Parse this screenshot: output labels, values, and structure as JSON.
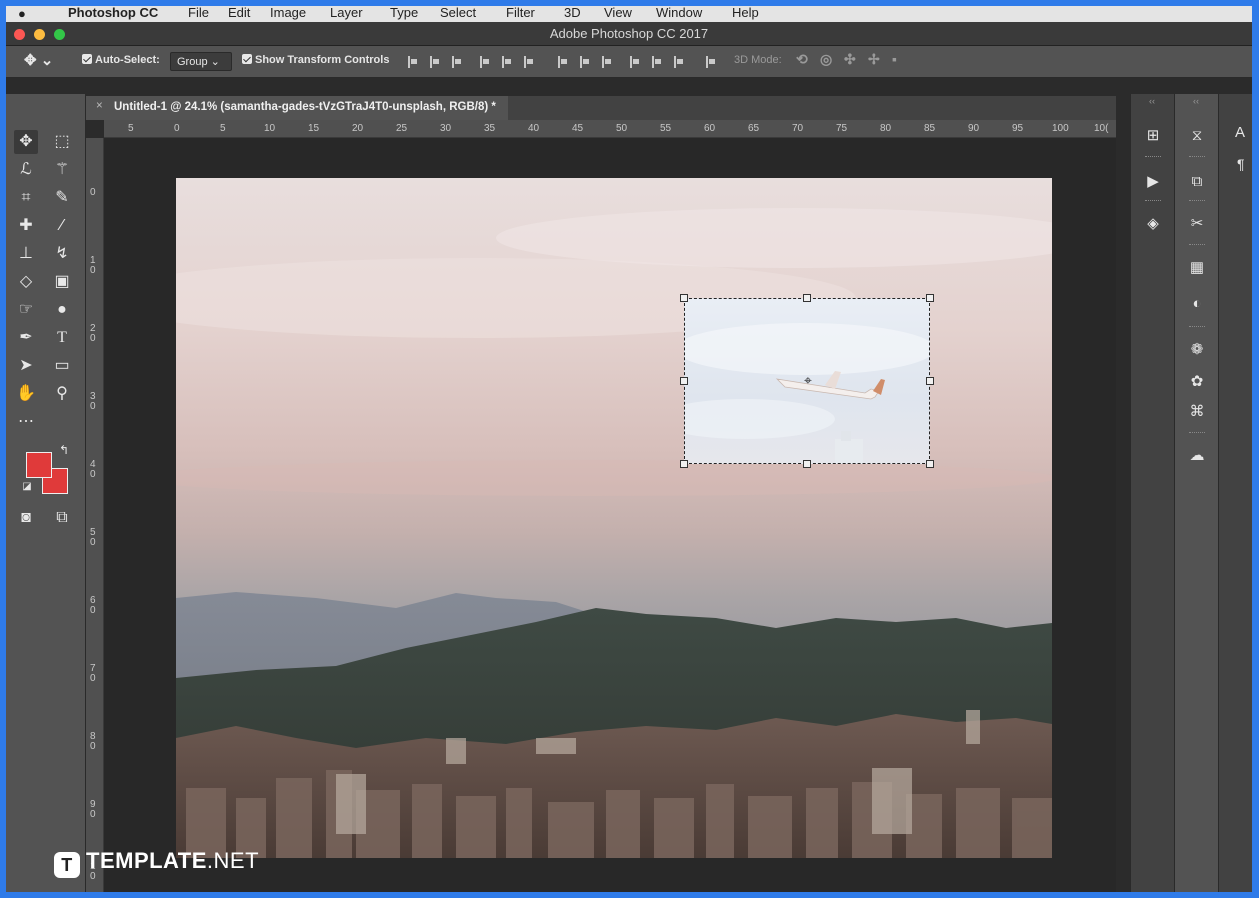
{
  "menubar": {
    "app": "Photoshop CC",
    "items": [
      "File",
      "Edit",
      "Image",
      "Layer",
      "Type",
      "Select",
      "Filter",
      "3D",
      "View",
      "Window",
      "Help"
    ]
  },
  "window": {
    "title": "Adobe Photoshop CC 2017"
  },
  "options_bar": {
    "auto_select_label": "Auto-Select:",
    "auto_select_value": "Group",
    "show_transform_label": "Show Transform Controls",
    "mode_3d_label": "3D Mode:"
  },
  "document": {
    "tab_label": "Untitled-1 @ 24.1% (samantha-gades-tVzGTraJ4T0-unsplash, RGB/8) *",
    "close_glyph": "×"
  },
  "rulers": {
    "top_labels": [
      "5",
      "0",
      "5",
      "10",
      "15",
      "20",
      "25",
      "30",
      "35",
      "40",
      "45",
      "50",
      "55",
      "60",
      "65",
      "70",
      "75",
      "80",
      "85",
      "90",
      "95",
      "100",
      "10("
    ],
    "left_labels": [
      "0",
      "1 0",
      "2 0",
      "3 0",
      "4 0",
      "5 0",
      "6 0",
      "7 0",
      "8 0",
      "9 0",
      "1 0"
    ]
  },
  "colors": {
    "foreground": "#e03a3a",
    "background": "#e03a3a",
    "accent_frame": "#2f7be9"
  },
  "icons": {
    "tools": [
      "move-tool-icon",
      "marquee-tool-icon",
      "lasso-tool-icon",
      "magic-wand-tool-icon",
      "crop-tool-icon",
      "eyedropper-tool-icon",
      "healing-brush-icon",
      "brush-tool-icon",
      "clone-stamp-icon",
      "history-brush-icon",
      "eraser-tool-icon",
      "gradient-tool-icon",
      "smudge-tool-icon",
      "dodge-tool-icon",
      "pen-tool-icon",
      "type-tool-icon",
      "path-select-icon",
      "rectangle-tool-icon",
      "hand-tool-icon",
      "zoom-tool-icon",
      "more-tools-icon",
      "quick-mask-icon",
      "screen-mode-icon"
    ],
    "dock1": [
      "libraries-icon",
      "actions-play-icon",
      "layers-icon"
    ],
    "dock2": [
      "history-icon",
      "properties-icon",
      "tool-presets-icon",
      "adjustments-icon",
      "styles-icon",
      "channels-icon",
      "swatches-icon",
      "paths-icon",
      "creative-cloud-icon"
    ]
  },
  "right_panel": {
    "collapsed_label": "A"
  },
  "watermark": {
    "brand": "TEMPLATE",
    "suffix": ".NET",
    "logo_letter": "T"
  }
}
